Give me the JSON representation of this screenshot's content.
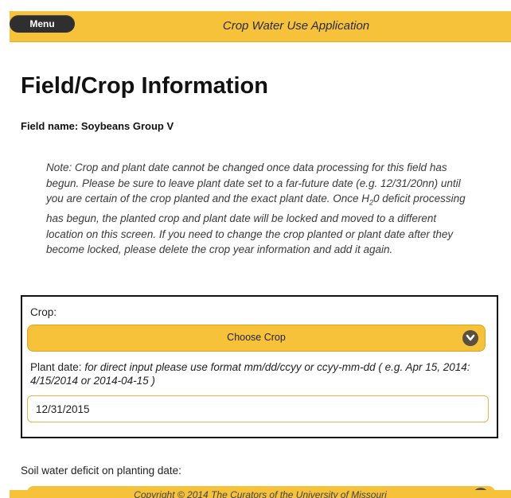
{
  "header": {
    "menu_label": "Menu",
    "app_title": "Crop Water Use Application"
  },
  "page": {
    "title": "Field/Crop Information",
    "field_name": "Field name: Soybeans Group V"
  },
  "note": {
    "part1": "Note: Crop and plant date cannot be changed once data processing for this field has begun. Please be sure to leave plant date set to a far-future date (e.g. 12/31/20nn) until you are certain of the crop planted and the exact plant date. Once H",
    "sub": "2",
    "part2": "0 deficit processing has begun, the planted crop and plant date will be locked and moved to a different location on this screen. If you need to change the crop planted or plant date after they become locked, please delete the crop year information and add it again."
  },
  "form": {
    "crop_label": "Crop:",
    "crop_select_value": "Choose Crop",
    "plant_date_label": "Plant date:",
    "plant_date_hint": "for direct input please use format mm/dd/ccyy or ccyy-mm-dd ( e.g. Apr 15, 2014: 4/15/2014 or 2014-04-15 )",
    "plant_date_value": "12/31/2015"
  },
  "soil": {
    "label": "Soil water deficit on planting date:"
  },
  "footer": {
    "copyright": "Copyright © 2014 The Curators of the University of Missouri"
  },
  "colors": {
    "accent": "#f5c23a",
    "menu_button": "#2f2f2f",
    "chevron_button": "#5a5040"
  },
  "icons": {
    "crop_select_chevron": "chevron-down-icon",
    "soil_select_chevron": "chevron-down-icon"
  }
}
